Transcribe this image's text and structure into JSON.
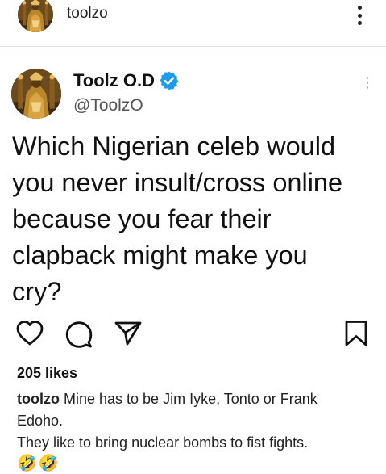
{
  "post": {
    "username": "toolzo",
    "likes": "205 likes",
    "caption": {
      "username": "toolzo",
      "lines": [
        "Mine has to be Jim Iyke, Tonto or Frank",
        "Edoho.",
        "They like to bring nuclear bombs to fist fights."
      ],
      "emojis": [
        "🤣",
        "🤣"
      ]
    }
  },
  "tweet": {
    "display_name": "Toolz O.D",
    "handle": "@ToolzO",
    "text_lines": [
      "Which Nigerian celeb would",
      "you never insult/cross online",
      "because you fear their",
      "clapback might make you",
      "cry?"
    ]
  },
  "icons": {
    "post_menu": "more-vertical-icon",
    "verified": "verified-badge-icon",
    "tweet_menu": "more-vertical-icon",
    "like": "heart-icon",
    "comment": "comment-icon",
    "share": "send-icon",
    "save": "bookmark-icon"
  },
  "colors": {
    "verified_blue": "#1d9bf0",
    "text": "#111111",
    "handle_gray": "#555555"
  }
}
